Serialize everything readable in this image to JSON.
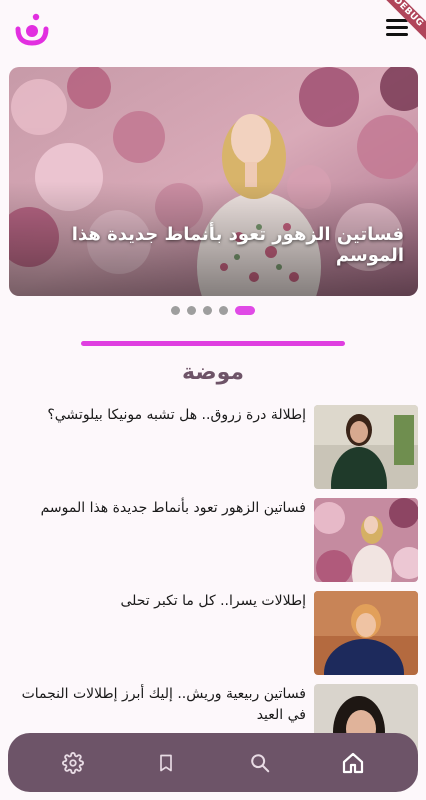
{
  "debug_banner": "DEBUG",
  "hero": {
    "caption": "فساتين الزهور تعود بأنماط جديدة هذا الموسم"
  },
  "carousel": {
    "total": 5,
    "active_index": 4
  },
  "section": {
    "title": "موضة"
  },
  "articles": [
    {
      "title": "إطلالة درة زروق.. هل تشبه مونيكا بيلوتشي؟"
    },
    {
      "title": "فساتين الزهور تعود بأنماط جديدة هذا الموسم"
    },
    {
      "title": "إطلالات يسرا.. كل ما تكبر تحلى"
    },
    {
      "title": "فساتين ربيعية وريش.. إليك أبرز إطلالات النجمات في العيد"
    }
  ],
  "bottom_nav": {
    "items": [
      {
        "icon": "gear-icon"
      },
      {
        "icon": "bookmark-icon"
      },
      {
        "icon": "search-icon"
      },
      {
        "icon": "home-icon",
        "active": true
      }
    ]
  },
  "colors": {
    "accent": "#df3fe0",
    "nav_background": "#6d5468",
    "section_title": "#6e5468"
  }
}
